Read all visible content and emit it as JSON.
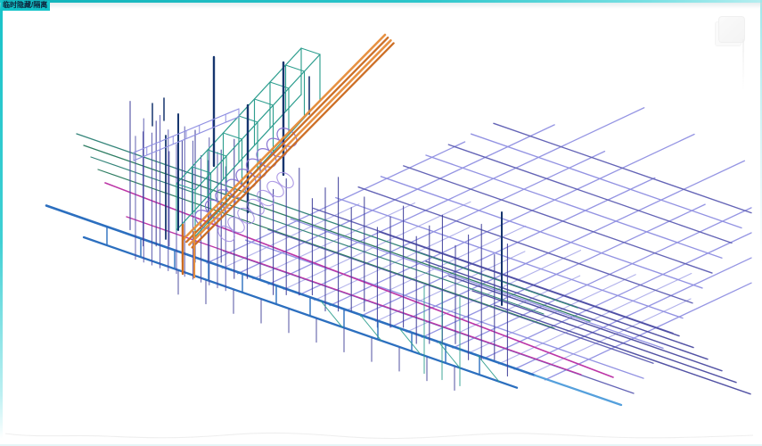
{
  "viewport": {
    "mode_badge": "临时隐藏/隔离",
    "background": "#FFFFFF"
  },
  "palette": {
    "frame_cyan": "#10B3BA",
    "badge_bg": "#12C3C9",
    "badge_text": "#0D2138",
    "blue": "#2C6FBF",
    "blue_light": "#55A0DC",
    "blue_mid": "#3E7FC8",
    "magenta": "#BC35A6",
    "teal": "#2E9E8F",
    "teal_dark": "#35857A",
    "green_dark": "#2E7D62",
    "navy": "#16356E",
    "slate": "#3E3E99",
    "slate_dark": "#4646A5",
    "slate_deep": "#4A4AA0",
    "peri_light": "#9090E2",
    "peri_dark": "#6060B4",
    "peri_xlight": "#A5A5E8",
    "purple": "#8672D2",
    "purple_light": "#A48FE2",
    "orange": "#E78E3C",
    "orange_dark": "#CC6B1F",
    "ghost_gray": "#ECECEC"
  }
}
